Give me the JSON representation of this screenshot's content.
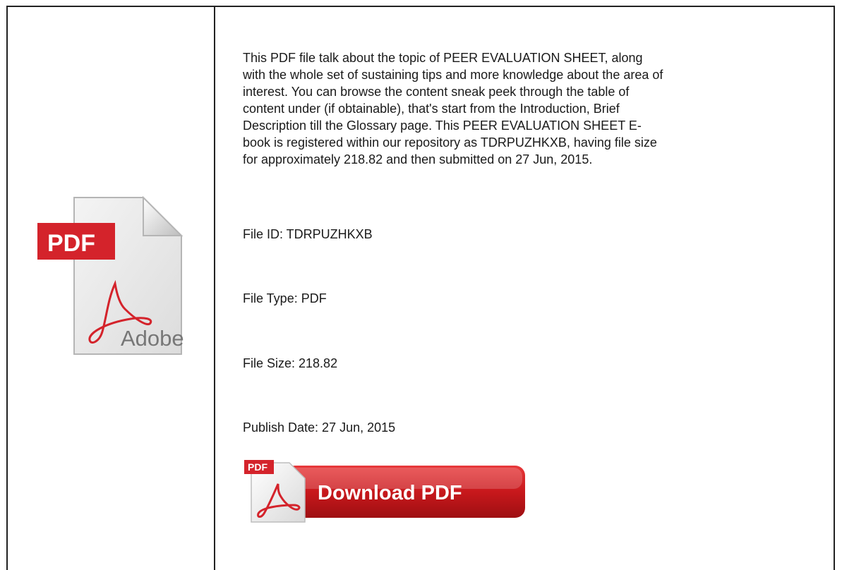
{
  "description_lines": [
    "This PDF file talk about the topic of PEER EVALUATION SHEET, along",
    "with the whole set of sustaining tips and more knowledge about the area of",
    "interest. You can browse the content sneak peek through the table of",
    "content under (if obtainable), that's start from the Introduction, Brief",
    "Description till the Glossary page. This PEER EVALUATION SHEET E-",
    "book is registered within our repository as TDRPUZHKXB, having file size",
    "for approximately 218.82 and then submitted on 27 Jun, 2015."
  ],
  "file_id": "File ID: TDRPUZHKXB",
  "file_type": "File Type: PDF",
  "file_size": "File Size: 218.82",
  "publish_date": "Publish Date: 27 Jun, 2015",
  "pdf_icon": {
    "icon": "pdf-document-icon",
    "tag_text": "PDF",
    "brand_text": "Adobe",
    "tag_color": "#d4232b"
  },
  "download_button": {
    "icon": "pdf-download-icon",
    "label": "Download PDF",
    "badge_text": "PDF",
    "button_color": "#c8181c"
  }
}
